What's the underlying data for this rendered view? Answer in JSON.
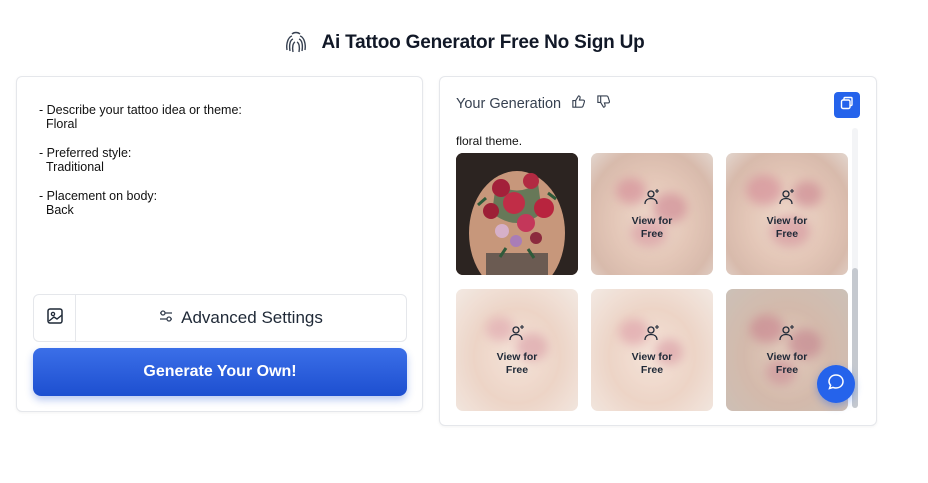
{
  "header": {
    "title": "Ai Tattoo Generator Free No Sign Up",
    "logo_icon": "fingerprint-icon"
  },
  "prompt": {
    "fields": [
      {
        "label": "- Describe your tattoo idea or theme:",
        "value": "Floral"
      },
      {
        "label": "- Preferred style:",
        "value": "Traditional"
      },
      {
        "label": "- Placement on body:",
        "value": "Back"
      }
    ]
  },
  "controls": {
    "image_upload_icon": "image-icon",
    "advanced_settings_label": "Advanced Settings",
    "advanced_settings_icon": "sliders-icon",
    "generate_label": "Generate Your Own!"
  },
  "results": {
    "title": "Your Generation",
    "caption": "floral theme.",
    "locked_label": "View for Free",
    "tiles": [
      {
        "locked": false
      },
      {
        "locked": true
      },
      {
        "locked": true
      },
      {
        "locked": true
      },
      {
        "locked": true
      },
      {
        "locked": true
      }
    ]
  },
  "colors": {
    "accent": "#2563eb",
    "button_gradient_top": "#3b6fe8",
    "button_gradient_bottom": "#1d4fd0"
  }
}
